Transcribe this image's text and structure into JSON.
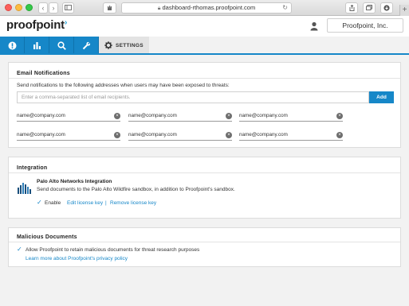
{
  "browser": {
    "url": "dashboard-rthomas.proofpoint.com",
    "nav_back": "‹",
    "nav_forward": "›",
    "plus": "+"
  },
  "header": {
    "logo": "proofpoint",
    "logo_mark": "›",
    "account_name": "Proofpoint, Inc."
  },
  "nav": {
    "tabs": [
      {
        "icon": "alert-icon"
      },
      {
        "icon": "bar-chart-icon"
      },
      {
        "icon": "search-icon"
      },
      {
        "icon": "wrench-icon"
      }
    ],
    "settings_label": "SETTINGS",
    "accent": "#1687c8"
  },
  "email_notifications": {
    "title": "Email Notifications",
    "description": "Send notifications to the following addresses when users may have been exposed to threats:",
    "input_placeholder": "Enter a comma-separated list of email recipients.",
    "add_label": "Add",
    "recipients": [
      "name@company.com",
      "name@company.com",
      "name@company.com",
      "name@company.com",
      "name@company.com",
      "name@company.com"
    ]
  },
  "integration": {
    "title": "Integration",
    "name": "Palo Alto Networks Integration",
    "description": "Send documents to the Palo Alto Wildfire sandbox, in addition to Proofpoint's sandbox.",
    "enable_label": "Enable",
    "enabled": true,
    "edit_link": "Edit license key",
    "separator": "|",
    "remove_link": "Remove license key"
  },
  "malicious_documents": {
    "title": "Malicious Documents",
    "checkbox_label": "Allow Proofpoint to retain malicious documents for threat research purposes",
    "checked": true,
    "privacy_link": "Learn more about Proofpoint's privacy policy"
  }
}
